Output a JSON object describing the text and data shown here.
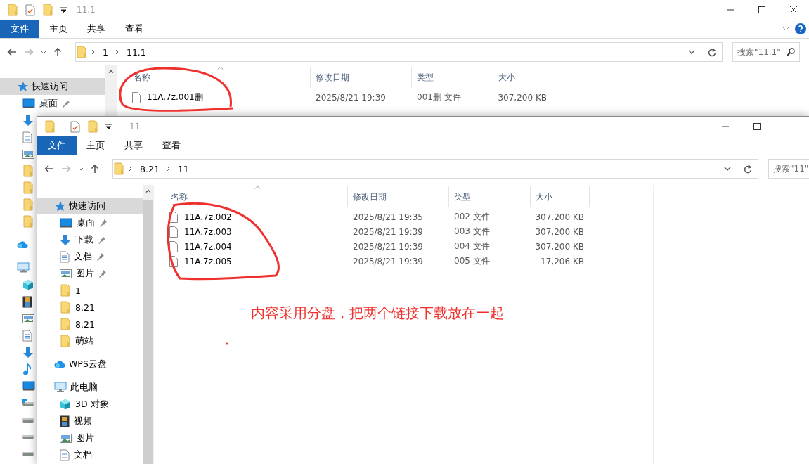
{
  "windows": [
    {
      "title": "11.1",
      "window_controls": [
        {
          "kind": "minimize"
        },
        {
          "kind": "maximize"
        },
        {
          "kind": "close"
        }
      ],
      "ribbon_tabs": [
        {
          "label": "文件",
          "selected": true
        },
        {
          "label": "主页",
          "selected": false
        },
        {
          "label": "共享",
          "selected": false
        },
        {
          "label": "查看",
          "selected": false
        }
      ],
      "path": [
        "1",
        "11.1"
      ],
      "search": {
        "placeholder": "搜索\"11.1\""
      },
      "sidebar": [
        {
          "label": "快速访问",
          "kind": "quick-access",
          "selected": true,
          "children": [
            {
              "label": "桌面",
              "kind": "desktop",
              "selected": false,
              "pinned": true
            },
            {
              "kind": "download",
              "selected": false
            },
            {
              "kind": "document",
              "selected": false
            },
            {
              "kind": "picture",
              "selected": false
            },
            {
              "kind": "folder",
              "selected": false
            },
            {
              "kind": "folder",
              "selected": false
            },
            {
              "kind": "folder",
              "selected": false
            },
            {
              "kind": "folder",
              "selected": false
            }
          ]
        },
        {
          "kind": "cloud",
          "selected": false
        },
        {
          "kind": "pc",
          "selected": false,
          "children": [
            {
              "kind": "cube",
              "selected": false
            },
            {
              "kind": "video",
              "selected": false
            },
            {
              "kind": "picture",
              "selected": false
            },
            {
              "kind": "document",
              "selected": false
            },
            {
              "kind": "download",
              "selected": false
            },
            {
              "kind": "music",
              "selected": false
            },
            {
              "kind": "desktop",
              "selected": false
            },
            {
              "kind": "drive-windows",
              "selected": false
            },
            {
              "kind": "drive",
              "selected": false
            },
            {
              "kind": "drive",
              "selected": false
            },
            {
              "kind": "drive",
              "selected": false
            }
          ]
        }
      ],
      "columns": [
        "名称",
        "修改日期",
        "类型",
        "大小"
      ],
      "rows": [
        {
          "name": "11A.7z.001删",
          "date": "2025/8/21 19:39",
          "type": "001删 文件",
          "size": "307,200 KB"
        }
      ]
    },
    {
      "title": "11",
      "window_controls": [
        {
          "kind": "minimize"
        },
        {
          "kind": "maximize"
        }
      ],
      "ribbon_tabs": [
        {
          "label": "文件",
          "selected": true
        },
        {
          "label": "主页",
          "selected": false
        },
        {
          "label": "共享",
          "selected": false
        },
        {
          "label": "查看",
          "selected": false
        }
      ],
      "path": [
        "8.21",
        "11"
      ],
      "search": {
        "placeholder": "搜索\"11\""
      },
      "sidebar": [
        {
          "label": "快速访问",
          "kind": "quick-access",
          "selected": true,
          "children": [
            {
              "label": "桌面",
              "kind": "desktop",
              "selected": false,
              "pinned": true
            },
            {
              "label": "下载",
              "kind": "download",
              "selected": false,
              "pinned": true
            },
            {
              "label": "文档",
              "kind": "document",
              "selected": false,
              "pinned": true
            },
            {
              "label": "图片",
              "kind": "picture",
              "selected": false,
              "pinned": true
            },
            {
              "label": "1",
              "kind": "folder",
              "selected": false,
              "pinned": false
            },
            {
              "label": "8.21",
              "kind": "folder",
              "selected": false,
              "pinned": false
            },
            {
              "label": "8.21",
              "kind": "folder",
              "selected": false,
              "pinned": false
            },
            {
              "label": "萌站",
              "kind": "folder",
              "selected": false,
              "pinned": false
            }
          ]
        },
        {
          "label": "WPS云盘",
          "kind": "cloud",
          "selected": false
        },
        {
          "label": "此电脑",
          "kind": "pc",
          "selected": false,
          "children": [
            {
              "label": "3D 对象",
              "kind": "cube",
              "selected": false
            },
            {
              "label": "视频",
              "kind": "video",
              "selected": false
            },
            {
              "label": "图片",
              "kind": "picture",
              "selected": false
            },
            {
              "label": "文档",
              "kind": "document",
              "selected": false
            }
          ]
        }
      ],
      "columns": [
        "名称",
        "修改日期",
        "类型",
        "大小"
      ],
      "rows": [
        {
          "name": "11A.7z.002",
          "date": "2025/8/21 19:35",
          "type": "002 文件",
          "size": "307,200 KB"
        },
        {
          "name": "11A.7z.003",
          "date": "2025/8/21 19:39",
          "type": "003 文件",
          "size": "307,200 KB"
        },
        {
          "name": "11A.7z.004",
          "date": "2025/8/21 19:39",
          "type": "004 文件",
          "size": "307,200 KB"
        },
        {
          "name": "11A.7z.005",
          "date": "2025/8/21 19:39",
          "type": "005 文件",
          "size": "17,206 KB"
        }
      ]
    }
  ],
  "annotation": {
    "note": "内容采用分盘，把两个链接下载放在一起"
  }
}
